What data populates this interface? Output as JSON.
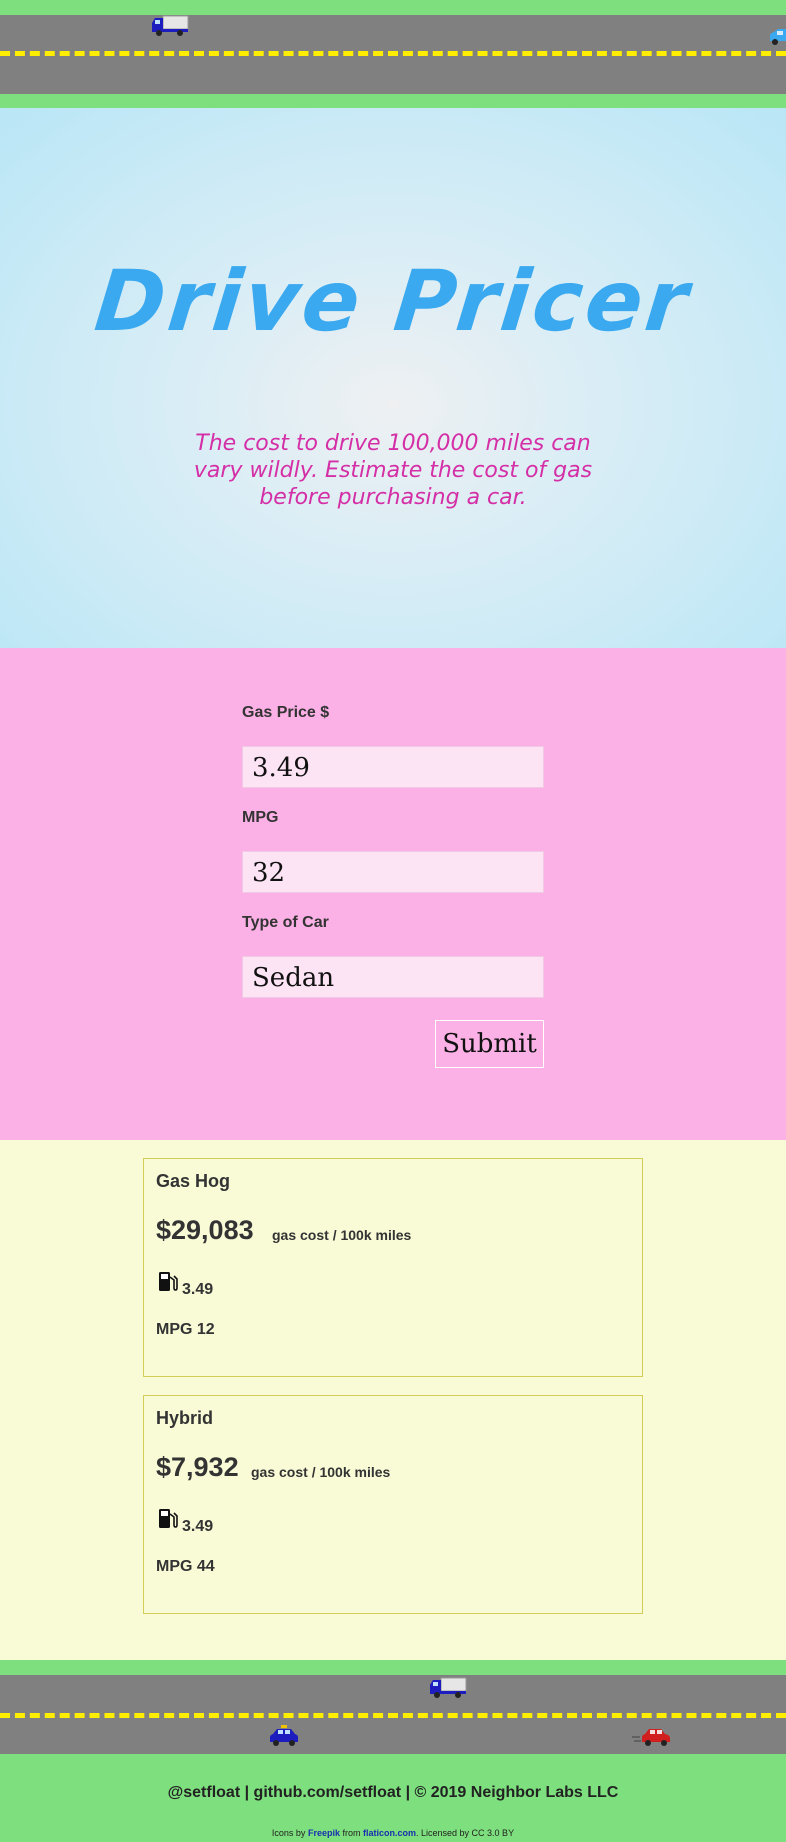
{
  "colors": {
    "grass": "#7ddf7d",
    "road": "#808080",
    "lane": "#ffee00",
    "title": "#3aa9ef",
    "tagline": "#d42fa6",
    "form_bg": "#fbb1e6",
    "results_bg": "#f9fad6",
    "card_border": "#d2cd55"
  },
  "header": {
    "title": "Drive Pricer",
    "tagline": "The cost to drive 100,000 miles can vary wildly. Estimate the cost of gas before purchasing a car."
  },
  "form": {
    "gas_price_label": "Gas Price $",
    "gas_price_value": "3.49",
    "mpg_label": "MPG",
    "mpg_value": "32",
    "car_type_label": "Type of Car",
    "car_type_value": "Sedan",
    "submit_label": "Submit"
  },
  "results": [
    {
      "name": "Gas Hog",
      "cost": "$29,083",
      "cost_label": "gas cost / 100k miles",
      "gas_icon": "gas-pump-icon",
      "price": "3.49",
      "mpg": "MPG 12"
    },
    {
      "name": "Hybrid",
      "cost": "$7,932",
      "cost_label": "gas cost / 100k miles",
      "gas_icon": "gas-pump-icon",
      "price": "3.49",
      "mpg": "MPG 44"
    }
  ],
  "footer": {
    "handle": "@setfloat",
    "sep1": "|",
    "repo": "github.com/setfloat",
    "sep2": "|",
    "copyright": "© 2019 Neighbor Labs LLC",
    "credit_prefix": "Icons by",
    "credit_author": "Freepik",
    "credit_from": "from",
    "credit_site": "flaticon.com",
    "credit_license": ". Licensed by CC 3.0 BY"
  }
}
